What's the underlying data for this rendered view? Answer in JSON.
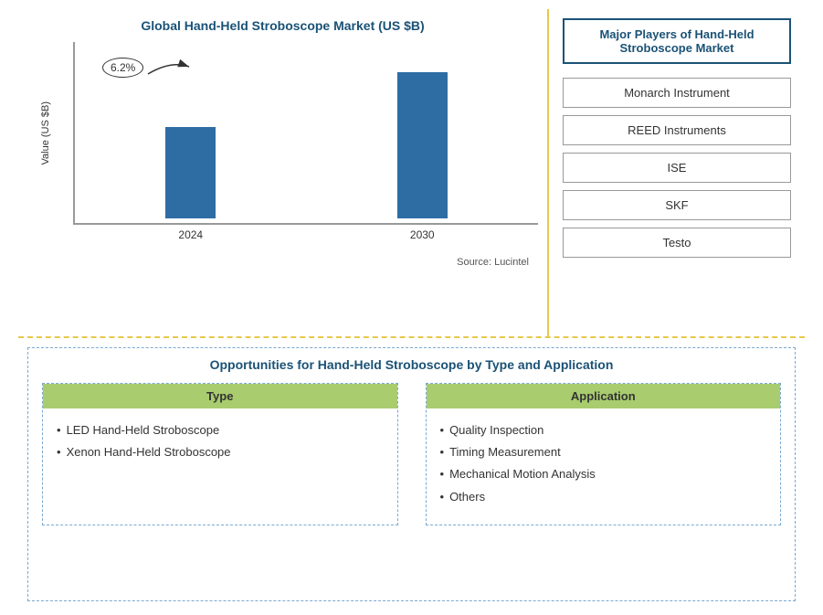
{
  "chart": {
    "title": "Global Hand-Held Stroboscope Market (US $B)",
    "y_axis_label": "Value (US $B)",
    "bar2024": {
      "label": "2024",
      "height": 100
    },
    "bar2030": {
      "label": "2030",
      "height": 160
    },
    "annotation_value": "6.2%",
    "source": "Source: Lucintel"
  },
  "players": {
    "title_line1": "Major Players of Hand-Held",
    "title_line2": "Stroboscope Market",
    "items": [
      {
        "name": "Monarch Instrument"
      },
      {
        "name": "REED Instruments"
      },
      {
        "name": "ISE"
      },
      {
        "name": "SKF"
      },
      {
        "name": "Testo"
      }
    ]
  },
  "opportunities": {
    "title": "Opportunities for Hand-Held Stroboscope by Type and Application",
    "type_column": {
      "header": "Type",
      "items": [
        "LED Hand-Held Stroboscope",
        "Xenon Hand-Held Stroboscope"
      ]
    },
    "application_column": {
      "header": "Application",
      "items": [
        "Quality Inspection",
        "Timing Measurement",
        "Mechanical Motion Analysis",
        "Others"
      ]
    }
  }
}
